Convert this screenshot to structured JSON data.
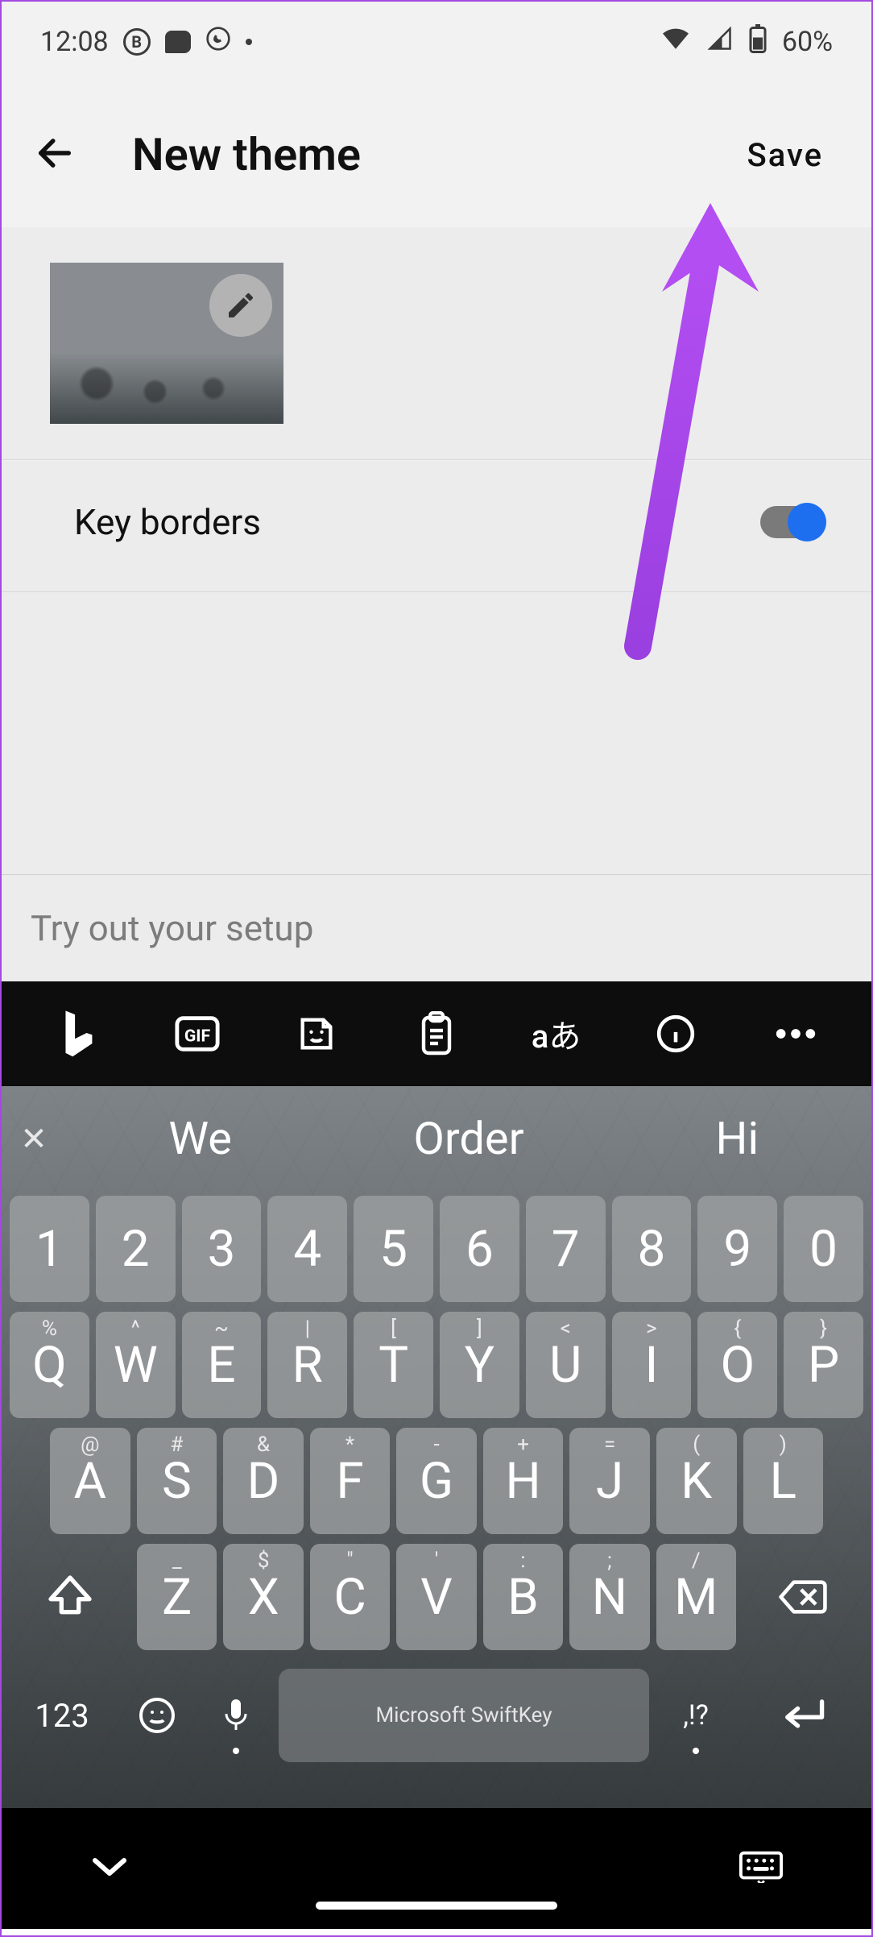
{
  "status": {
    "time": "12:08",
    "battery": "60%",
    "icons": [
      "b-circle",
      "chat",
      "whatsapp",
      "dot"
    ],
    "right_icons": [
      "wifi",
      "signal",
      "battery"
    ]
  },
  "header": {
    "title": "New theme",
    "save_label": "Save",
    "back_icon": "arrow-left"
  },
  "theme": {
    "edit_icon": "pencil",
    "toggle_label": "Key borders",
    "toggle_on": true
  },
  "tryout": {
    "placeholder": "Try out your setup"
  },
  "toolbar_icons": [
    "bing",
    "gif",
    "sticker",
    "clipboard",
    "translate",
    "info",
    "more"
  ],
  "suggestions": {
    "close": "✕",
    "items": [
      "We",
      "Order",
      "Hi"
    ]
  },
  "keys": {
    "row1": [
      "1",
      "2",
      "3",
      "4",
      "5",
      "6",
      "7",
      "8",
      "9",
      "0"
    ],
    "row2": {
      "main": [
        "Q",
        "W",
        "E",
        "R",
        "T",
        "Y",
        "U",
        "I",
        "O",
        "P"
      ],
      "alt": [
        "%",
        "^",
        "~",
        "|",
        "[",
        "]",
        "<",
        ">",
        "{",
        "}"
      ]
    },
    "row3": {
      "main": [
        "A",
        "S",
        "D",
        "F",
        "G",
        "H",
        "J",
        "K",
        "L"
      ],
      "alt": [
        "@",
        "#",
        "&",
        "*",
        "-",
        "+",
        "=",
        "(",
        ")"
      ]
    },
    "row4": {
      "main": [
        "Z",
        "X",
        "C",
        "V",
        "B",
        "N",
        "M"
      ],
      "alt": [
        "_",
        "$",
        "\"",
        "'",
        ":",
        ";",
        "/"
      ]
    },
    "numbers_label": "123",
    "punct_label": ",!?",
    "space_label": "Microsoft SwiftKey"
  },
  "navbar": {
    "left_icon": "chevron-down",
    "right_icon": "keyboard"
  }
}
